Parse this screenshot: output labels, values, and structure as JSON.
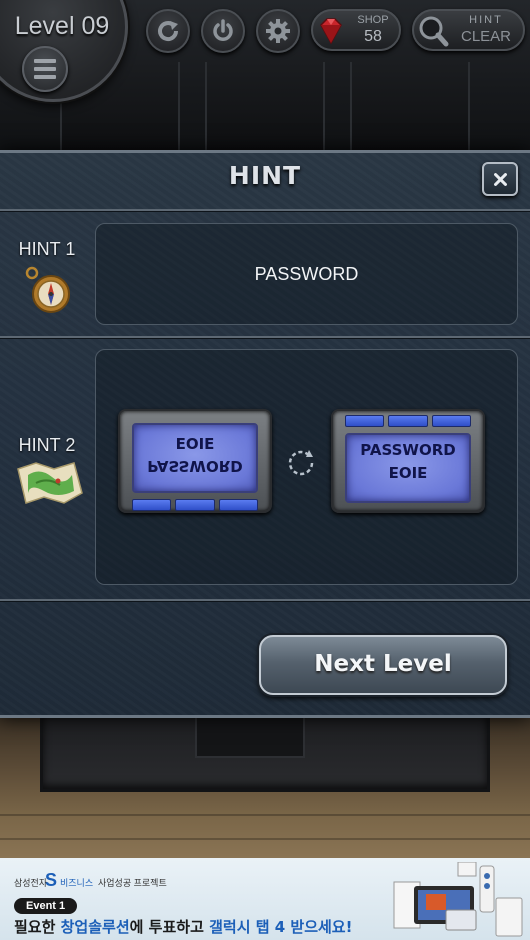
{
  "hud": {
    "level_label": "Level 09",
    "shop": {
      "label": "SHOP",
      "count": "58"
    },
    "hint": {
      "label": "HINT",
      "action": "CLEAR"
    },
    "icons": [
      "refresh-icon",
      "power-icon",
      "gear-icon",
      "gem-icon",
      "magnifier-icon",
      "menu-icon"
    ]
  },
  "hint_panel": {
    "title": "HINT",
    "hint1": {
      "label": "HINT 1",
      "text": "PASSWORD"
    },
    "hint2": {
      "label": "HINT 2",
      "screen_before": {
        "line1": "EOIE",
        "line2": "PASSWORD"
      },
      "screen_after": {
        "line1": "PASSWORD",
        "line2": "EOIE"
      }
    },
    "next_label": "Next Level"
  },
  "ad": {
    "brand": "삼성전자",
    "s_logo": "S",
    "business": "비즈니스",
    "project": "사업성공 프로젝트",
    "event": "Event 1",
    "headline_a": "필요한 ",
    "headline_b": "창업솔루션",
    "headline_c": "에 투표하고 ",
    "headline_d": "갤럭시 탭 4 받으세요!"
  },
  "colors": {
    "panel": "#243140",
    "screen": "#7a88e0",
    "key_blue": "#3f60dc",
    "ad_blue": "#1c5fb8"
  }
}
